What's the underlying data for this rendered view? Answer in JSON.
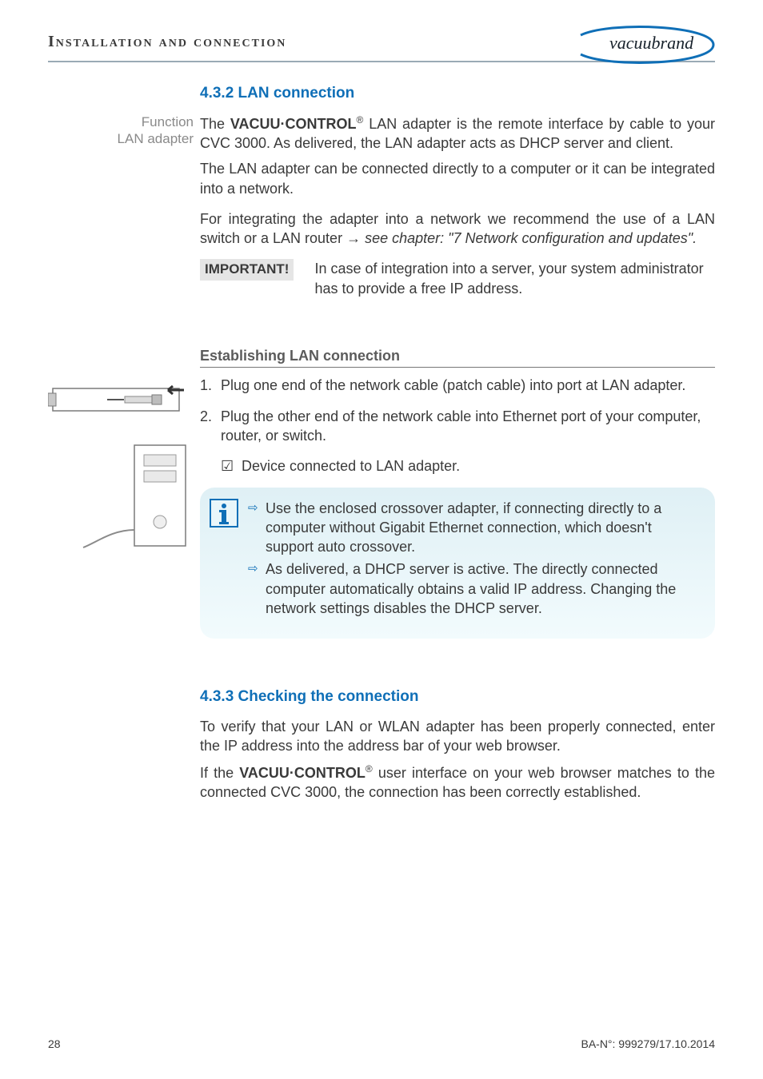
{
  "header": {
    "chapter_title": "Installation and connection",
    "brand": "vacuubrand"
  },
  "section1": {
    "heading": "4.3.2 LAN connection",
    "sidenote_line1": "Function",
    "sidenote_line2": "LAN adapter",
    "p1_a": "The ",
    "p1_brand": "VACUU·CONTROL",
    "p1_reg": "®",
    "p1_b": " LAN adapter is the remote interface by cable to your CVC 3000. As delivered, the LAN adapter acts as DHCP server and client.",
    "p2": "The LAN adapter can be connected directly to a computer or it can be integrated into a network.",
    "p3_a": "For integrating the adapter into a network we recommend the use of a LAN switch or a LAN router ",
    "p3_arrow": "→",
    "p3_b": " see chapter: \"7 Network configuration and updates\".",
    "important_label": "IMPORTANT!",
    "important_text": "In case of integration into a server, your system administrator has to provide a free IP address."
  },
  "section2": {
    "heading": "Establishing LAN connection",
    "step1": "Plug one end of the network cable (patch cable) into port at LAN adapter.",
    "step2": "Plug the other end of the network cable into Ethernet port of your computer, router, or switch.",
    "check_sym": "☑",
    "check_text": "Device connected to LAN adapter.",
    "info1": "Use the enclosed crossover adapter, if connecting directly to a computer without Gigabit Ethernet connection, which doesn't support auto crossover.",
    "info2": "As delivered, a DHCP server is active. The directly connected computer automatically obtains a valid IP address. Changing the network settings disables the DHCP server."
  },
  "section3": {
    "heading": "4.3.3 Checking the connection",
    "p1": "To verify that your LAN or WLAN adapter has been properly connected, enter the IP address into the address bar of your web browser.",
    "p2_a": "If the ",
    "p2_brand": "VACUU·CONTROL",
    "p2_reg": "®",
    "p2_b": " user interface on your web browser matches to the connected CVC 3000, the connection has been correctly established."
  },
  "footer": {
    "page_number": "28",
    "doc_ref": "BA-N°: 999279/17.10.2014"
  }
}
